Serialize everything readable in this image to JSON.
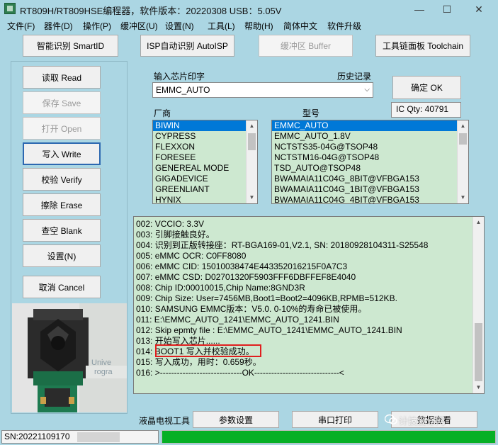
{
  "window": {
    "title": "RT809H/RT809HSE编程器，软件版本：20220308  USB：5.05V",
    "minimize_glyph": "—",
    "maximize_glyph": "☐",
    "close_glyph": "✕"
  },
  "menu": {
    "items": [
      {
        "label": "文件(F)"
      },
      {
        "label": "器件(D)"
      },
      {
        "label": "操作(P)"
      },
      {
        "label": "缓冲区(U)"
      },
      {
        "label": "设置(N)"
      },
      {
        "label": "工具(L)"
      },
      {
        "label": "帮助(H)"
      },
      {
        "label": "简体中文"
      },
      {
        "label": "软件升级"
      }
    ]
  },
  "toolbar": {
    "smartid_label": "智能识别 SmartID",
    "isp_label": "ISP自动识别 AutoISP",
    "buffer_label": "缓冲区 Buffer",
    "toolchain_label": "工具链面板 Toolchain"
  },
  "ops": {
    "read_label": "读取 Read",
    "save_label": "保存 Save",
    "open_label": "打开 Open",
    "write_label": "写入 Write",
    "verify_label": "校验 Verify",
    "erase_label": "擦除 Erase",
    "blank_label": "查空 Blank",
    "settings_label": "设置(N)",
    "cancel_label": "取消 Cancel"
  },
  "chip": {
    "input_label": "输入芯片印字",
    "history_label": "历史记录",
    "value": "EMMC_AUTO",
    "confirm_label": "确定 OK",
    "ic_qty": "IC Qty: 40791"
  },
  "vendors": {
    "header": "厂商",
    "items": [
      "BIWIN",
      "CYPRESS",
      "FLEXXON",
      "FORESEE",
      "GENEREAL MODE",
      "GIGADEVICE",
      "GREENLIANT",
      "HYNIX"
    ],
    "selected_index": 0
  },
  "models": {
    "header": "型号",
    "items": [
      "EMMC_AUTO",
      "EMMC_AUTO_1.8V",
      "NCTSTS35-04G@TSOP48",
      "NCTSTM16-04G@TSOP48",
      "TSD_AUTO@TSOP48",
      "BWAMAIA11C04G_8BIT@VFBGA153",
      "BWAMAIA11C04G_1BIT@VFBGA153",
      "BWAMAIA11C04G_4BIT@VFBGA153"
    ],
    "selected_index": 0
  },
  "log": {
    "lines": [
      "002:  VCCIO: 3.3V",
      "003:  引脚接触良好。",
      "004:  识别到正版转接座：RT-BGA169-01,V2.1, SN: 20180928104311-S25548",
      "005:  eMMC OCR: C0FF8080",
      "006:  eMMC CID:  15010038474E443352016215F0A7C3",
      "007:  eMMC CSD: D02701320F5903FFF6DBFFEF8E4040",
      "008:  Chip ID:00010015,Chip Name:8GND3R",
      "009:  Chip Size: User=7456MB,Boot1=Boot2=4096KB,RPMB=512KB.",
      "010:  SAMSUNG EMMC版本：V5.0.   0-10%的寿命已被使用。",
      "011:  E:\\EMMC_AUTO_1241\\EMMC_AUTO_1241.BIN",
      "012:  Skip epmty file : E:\\EMMC_AUTO_1241\\EMMC_AUTO_1241.BIN",
      "013:  开始写入芯片......",
      "014:  BOOT1 写入并校验成功。",
      "015:  写入成功，用时：0.659秒。",
      "016:  >-----------------------------OK------------------------------<"
    ]
  },
  "device_image": {
    "partial_text_1": "Unive",
    "partial_text_2": "rogra"
  },
  "bottom_tabs": {
    "lcd_tool_label": "液晶电视工具",
    "params_label": "参数设置",
    "serial_label": "串口打印",
    "data_label": "数据查看"
  },
  "status": {
    "sn": "SN:20221109170",
    "progress_fraction": 1.0
  },
  "watermark": {
    "text": "计技爱修网"
  },
  "colors": {
    "background": "#abd6e3",
    "list_background": "#cde8d0",
    "selection": "#0078d7",
    "progress": "#06b025",
    "highlight_box": "#e01e1e"
  }
}
